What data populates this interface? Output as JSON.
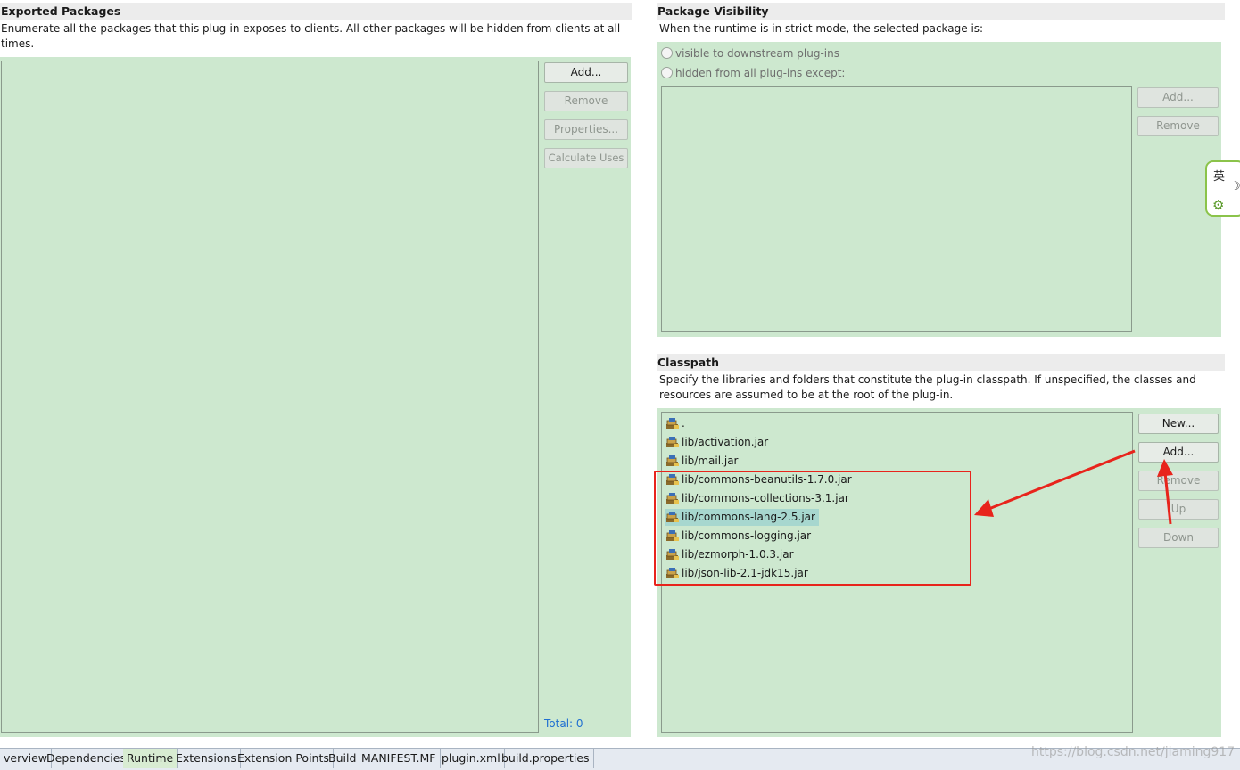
{
  "exported": {
    "title": "Exported Packages",
    "desc_line1": "Enumerate all the packages that this plug-in exposes to clients.  All other packages will be hidden from clients at all",
    "desc_line2": "times.",
    "buttons": {
      "add": "Add...",
      "remove": "Remove",
      "properties": "Properties...",
      "calculate_uses": "Calculate Uses"
    },
    "total": "Total: 0"
  },
  "visibility": {
    "title": "Package Visibility",
    "desc": "When the runtime is in strict mode, the selected package is:",
    "radio_visible": "visible to downstream plug-ins",
    "radio_hidden": "hidden from all plug-ins except:",
    "buttons": {
      "add": "Add...",
      "remove": "Remove"
    }
  },
  "classpath": {
    "title": "Classpath",
    "desc_line1": "Specify the libraries and folders that constitute the plug-in classpath.  If unspecified, the classes and",
    "desc_line2": "resources are assumed to be at the root of the plug-in.",
    "items": [
      ".",
      "lib/activation.jar",
      "lib/mail.jar",
      "lib/commons-beanutils-1.7.0.jar",
      "lib/commons-collections-3.1.jar",
      "lib/commons-lang-2.5.jar",
      "lib/commons-logging.jar",
      "lib/ezmorph-1.0.3.jar",
      "lib/json-lib-2.1-jdk15.jar"
    ],
    "selected_item": "lib/commons-lang-2.5.jar",
    "buttons": {
      "new": "New...",
      "add": "Add...",
      "remove": "Remove",
      "up": "Up",
      "down": "Down"
    }
  },
  "tabs": [
    "verview",
    "Dependencies",
    "Runtime",
    "Extensions",
    "Extension Points",
    "Build",
    "MANIFEST.MF",
    "plugin.xml",
    "build.properties"
  ],
  "active_tab": "Runtime",
  "ime": {
    "lang": "英"
  },
  "watermark": "https://blog.csdn.net/jiaming917",
  "colors": {
    "section_bg": "#cde8cf",
    "annotation_red": "#e8241c",
    "link_blue": "#1f6fd1"
  }
}
